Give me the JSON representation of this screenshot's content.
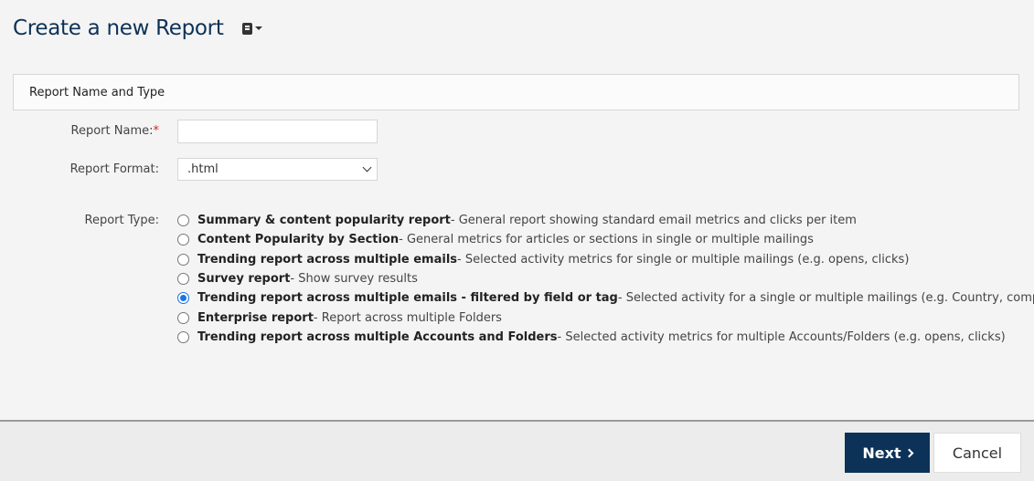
{
  "page": {
    "title": "Create a new Report",
    "help_menu_icon": "book-icon"
  },
  "section": {
    "title": "Report Name and Type"
  },
  "form": {
    "report_name_label": "Report Name:",
    "required_marker": "*",
    "report_name_value": "",
    "report_format_label": "Report Format:",
    "report_format_selected": ".html",
    "report_type_label": "Report Type:",
    "report_types": [
      {
        "name": "Summary & content popularity report",
        "description": " - General report showing standard email metrics and clicks per item",
        "checked": false
      },
      {
        "name": "Content Popularity by Section",
        "description": " - General metrics for articles or sections in single or multiple mailings",
        "checked": false
      },
      {
        "name": "Trending report across multiple emails",
        "description": " - Selected activity metrics for single or multiple mailings (e.g. opens, clicks)",
        "checked": false
      },
      {
        "name": "Survey report",
        "description": " - Show survey results",
        "checked": false
      },
      {
        "name": "Trending report across multiple emails - filtered by field or tag",
        "description": " - Selected activity for a single or multiple mailings (e.g. Country, company)",
        "checked": true
      },
      {
        "name": "Enterprise report",
        "description": " - Report across multiple Folders",
        "checked": false
      },
      {
        "name": "Trending report across multiple Accounts and Folders",
        "description": " - Selected activity metrics for multiple Accounts/Folders (e.g. opens, clicks)",
        "checked": false
      }
    ]
  },
  "footer": {
    "next_label": "Next",
    "cancel_label": "Cancel"
  },
  "colors": {
    "primary": "#0d3257",
    "radio_selected": "#1a73e8",
    "required": "#d9232d"
  }
}
